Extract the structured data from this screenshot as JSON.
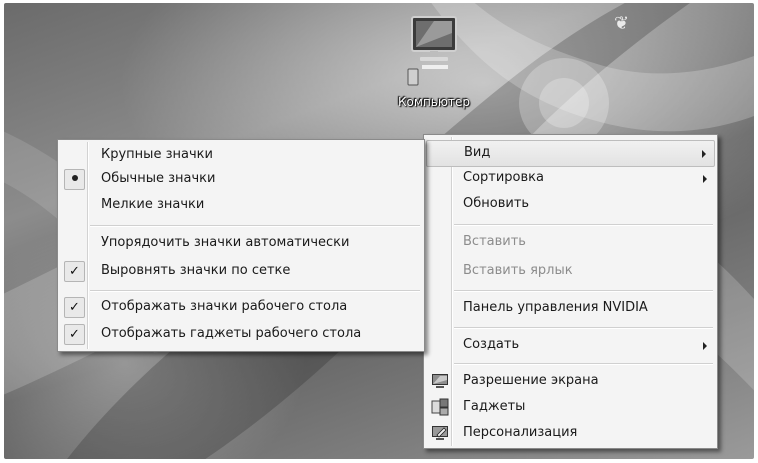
{
  "desktop": {
    "computer_icon_label": "Компьютер"
  },
  "context_menu": {
    "items": [
      {
        "label": "Вид",
        "submenu": true,
        "highlighted": true
      },
      {
        "label": "Сортировка",
        "submenu": true
      },
      {
        "label": "Обновить"
      },
      {
        "label": "Вставить",
        "disabled": true
      },
      {
        "label": "Вставить ярлык",
        "disabled": true
      },
      {
        "label": "Панель управления NVIDIA"
      },
      {
        "label": "Создать",
        "submenu": true
      },
      {
        "label": "Разрешение экрана",
        "icon": "screen-resolution-icon"
      },
      {
        "label": "Гаджеты",
        "icon": "gadgets-icon"
      },
      {
        "label": "Персонализация",
        "icon": "personalization-icon"
      }
    ]
  },
  "view_submenu": {
    "items": [
      {
        "label": "Крупные значки"
      },
      {
        "label": "Обычные значки",
        "mark": "bullet"
      },
      {
        "label": "Мелкие значки"
      },
      {
        "label": "Упорядочить значки автоматически"
      },
      {
        "label": "Выровнять значки по сетке",
        "mark": "check"
      },
      {
        "label": "Отображать значки рабочего стола",
        "mark": "check"
      },
      {
        "label": "Отображать гаджеты  рабочего стола",
        "mark": "check"
      }
    ],
    "check_glyph": "✓"
  }
}
